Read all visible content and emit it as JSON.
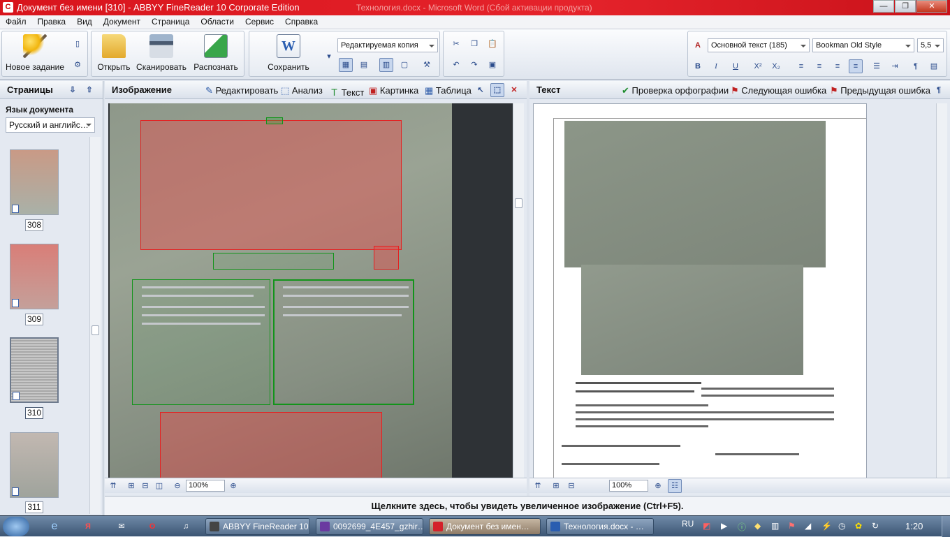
{
  "window": {
    "title": "Документ без имени [310] - ABBYY FineReader 10 Corporate Edition",
    "ghost_title": "Технология.docx - Microsoft Word (Сбой активации продукта)"
  },
  "menu": [
    "Файл",
    "Правка",
    "Вид",
    "Документ",
    "Страница",
    "Области",
    "Сервис",
    "Справка"
  ],
  "toolbar": {
    "new_task": "Новое задание",
    "open": "Открыть",
    "scan": "Сканировать",
    "recognize": "Распознать",
    "save": "Сохранить",
    "save_format": "Редактируемая копия",
    "style": "Основной текст (185)",
    "font": "Bookman Old Style",
    "size": "5,5"
  },
  "pages_panel": {
    "title": "Страницы",
    "lang_label": "Язык документа",
    "lang_value": "Русский и английс…",
    "pages": [
      "308",
      "309",
      "310",
      "311"
    ],
    "selected": "310"
  },
  "image_panel": {
    "title": "Изображение",
    "tools": [
      "Редактировать",
      "Анализ",
      "Текст",
      "Картинка",
      "Таблица"
    ],
    "zoom": "100%"
  },
  "text_panel": {
    "title": "Текст",
    "spell": "Проверка орфографии",
    "next_err": "Следующая ошибка",
    "prev_err": "Предыдущая ошибка",
    "zoom": "100%"
  },
  "hint": "Щелкните здесь, чтобы увидеть увеличенное изображение (Ctrl+F5).",
  "taskbar": {
    "tasks": [
      "ABBYY FineReader 10",
      "0092699_4E457_gzhir…",
      "Документ без имен…",
      "Технология.docx - …"
    ],
    "lang": "RU",
    "clock": "1:20"
  },
  "colors": {
    "title_red": "#e5232b",
    "zone_red": "#e52020",
    "zone_green": "#12941a"
  }
}
